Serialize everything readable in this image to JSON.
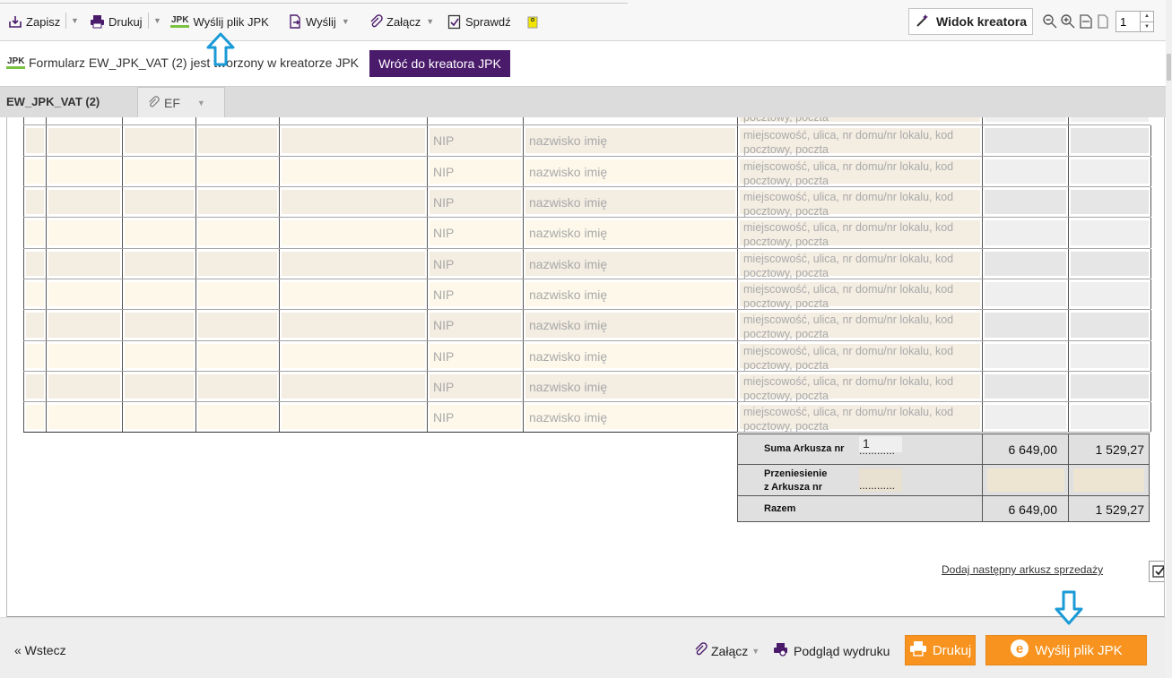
{
  "toolbar": {
    "save": "Zapisz",
    "print": "Drukuj",
    "send_jpk": "Wyślij plik JPK",
    "send": "Wyślij",
    "attach": "Załącz",
    "check": "Sprawdź",
    "creator_view": "Widok kreatora",
    "page_number": "1",
    "jpk_badge": "JPK"
  },
  "info": {
    "text": "Formularz EW_JPK_VAT (2) jest tworzony w kreatorze JPK",
    "back_button": "Wróć do kreatora JPK"
  },
  "tabs": [
    {
      "label": "EW_JPK_VAT (2)"
    },
    {
      "label": "EF"
    }
  ],
  "table": {
    "top_partial_addr": "pocztowy, poczta",
    "nip_placeholder": "NIP",
    "name_placeholder": "nazwisko imię",
    "rows": [
      {
        "addr1": "miejscowość, ulica, nr domu/nr lokalu, kod",
        "addr2": "pocztowy, poczta"
      },
      {
        "addr1": "miejscowość, ulica, nr domu/nr lokalu, kod",
        "addr2": "pocztowy, poczta"
      },
      {
        "addr1": "miejscowość, ulica, nr domu/nr lokalu, kod",
        "addr2": "pocztowy, poczta"
      },
      {
        "addr1": "miejscowość, ulica, nr domu/nr lokalu, kod",
        "addr2": "pocztowy, poczta"
      },
      {
        "addr1": "miejscowość, ulica, nr domu/nr lokalu, kod",
        "addr2": "pocztowy, poczta"
      },
      {
        "addr1": "miejscowość, ulica, nr domu/nr lokalu, kod",
        "addr2": "pocztowy, poczta"
      },
      {
        "addr1": "miejscowość, ulica, nr domu/nr lokalu, kod",
        "addr2": "pocztowy, poczta"
      },
      {
        "addr1": "miejscowość, ulica, nr domu/nr lokalu, kod",
        "addr2": "pocztowy, poczta"
      },
      {
        "addr1": "miejscowość, ulica, nr domu/nr lokalu, kod",
        "addr2": "pocztowy, poczta"
      },
      {
        "addr1": "miejscowość, ulica, nr domu/nr lokalu, kod",
        "addr2": "pocztowy, poczta"
      }
    ]
  },
  "summary": {
    "sum_label": "Suma Arkusza nr",
    "sum_sheet_no": "1",
    "dots": "............",
    "sum_value1": "6 649,00",
    "sum_value2": "1 529,27",
    "transfer_label_1": "Przeniesienie",
    "transfer_label_2": "z Arkusza nr",
    "total_label": "Razem",
    "total_value1": "6 649,00",
    "total_value2": "1 529,27"
  },
  "add_sheet": "Dodaj następny arkusz sprzedaży",
  "bottom": {
    "back": "« Wstecz",
    "attach": "Załącz",
    "preview": "Podgląd wydruku",
    "print": "Drukuj",
    "send_jpk": "Wyślij plik JPK"
  },
  "colors": {
    "accent_purple": "#4a1a6b",
    "orange": "#f7931e",
    "arrow_blue": "#1a9ad6",
    "jpk_green": "#7cc242"
  }
}
